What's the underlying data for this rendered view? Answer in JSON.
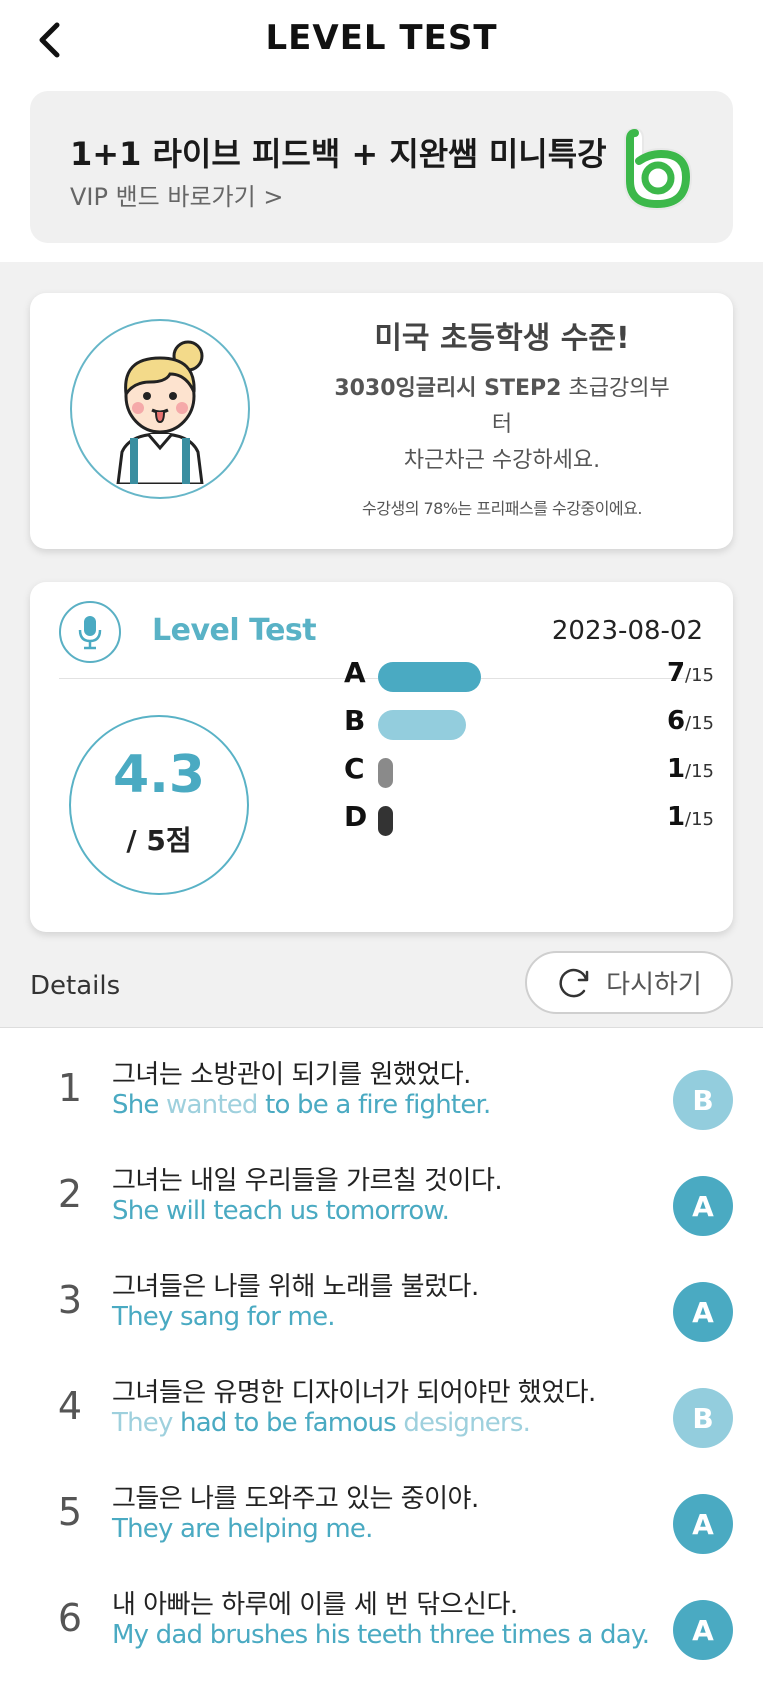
{
  "header": {
    "title": "LEVEL TEST",
    "back_icon": "chevron-left-icon"
  },
  "banner": {
    "title": "1+1 라이브 피드백 + 지완쌤 미니특강",
    "subtitle": "VIP 밴드 바로가기 >",
    "logo_icon": "band-logo-icon"
  },
  "result": {
    "headline": "미국 초등학생 수준!",
    "desc_bold": "3030잉글리시 STEP2",
    "desc_rest": " 초급강의부",
    "desc_line2": "터",
    "desc_line3": "차근차근 수강하세요.",
    "note": "수강생의 78%는 프리패스를 수강중이에요."
  },
  "level_test": {
    "label": "Level Test",
    "date": "2023-08-02",
    "score": "4.3",
    "score_unit": "/ 5점",
    "total_label": "/15",
    "grades": [
      {
        "letter": "A",
        "count": "7",
        "fraction": 0.4667,
        "color": "#4aaac2"
      },
      {
        "letter": "B",
        "count": "6",
        "fraction": 0.4,
        "color": "#93cddd"
      },
      {
        "letter": "C",
        "count": "1",
        "fraction": 0.0667,
        "color": "#8a8a8a"
      },
      {
        "letter": "D",
        "count": "1",
        "fraction": 0.0667,
        "color": "#333333"
      }
    ]
  },
  "details": {
    "label": "Details",
    "retry_label": "다시하기",
    "retry_icon": "refresh-icon"
  },
  "questions": [
    {
      "num": "1",
      "ko": "그녀는 소방관이 되기를 원했었다.",
      "en_parts": [
        {
          "t": "She ",
          "dim": false
        },
        {
          "t": "wanted",
          "dim": true
        },
        {
          "t": " to be a fire fighter.",
          "dim": false
        }
      ],
      "grade": "B"
    },
    {
      "num": "2",
      "ko": "그녀는 내일 우리들을 가르칠 것이다.",
      "en_parts": [
        {
          "t": "She will teach us tomorrow.",
          "dim": false
        }
      ],
      "grade": "A"
    },
    {
      "num": "3",
      "ko": "그녀들은 나를 위해 노래를 불렀다.",
      "en_parts": [
        {
          "t": "They sang for me.",
          "dim": false
        }
      ],
      "grade": "A"
    },
    {
      "num": "4",
      "ko": "그녀들은 유명한 디자이너가 되어야만 했었다.",
      "en_parts": [
        {
          "t": "They",
          "dim": true
        },
        {
          "t": " had to be famous ",
          "dim": false
        },
        {
          "t": "designers.",
          "dim": true
        }
      ],
      "grade": "B"
    },
    {
      "num": "5",
      "ko": "그들은 나를 도와주고 있는 중이야.",
      "en_parts": [
        {
          "t": "They are helping me.",
          "dim": false
        }
      ],
      "grade": "A"
    },
    {
      "num": "6",
      "ko": "내 아빠는 하루에 이를 세 번 닦으신다.",
      "en_parts": [
        {
          "t": "My dad brushes his teeth three times a day.",
          "dim": false
        }
      ],
      "grade": "A"
    }
  ],
  "colors": {
    "accent": "#4aaac2",
    "accent_light": "#93cddd",
    "grade_A": "#4aaac2",
    "grade_B": "#93cddd"
  }
}
